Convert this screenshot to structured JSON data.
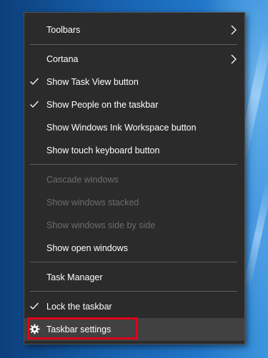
{
  "menu": {
    "items": [
      {
        "label": "Toolbars",
        "submenu": true,
        "checked": false,
        "enabled": true
      },
      {
        "label": "Cortana",
        "submenu": true,
        "checked": false,
        "enabled": true
      },
      {
        "label": "Show Task View button",
        "submenu": false,
        "checked": true,
        "enabled": true
      },
      {
        "label": "Show People on the taskbar",
        "submenu": false,
        "checked": true,
        "enabled": true
      },
      {
        "label": "Show Windows Ink Workspace button",
        "submenu": false,
        "checked": false,
        "enabled": true
      },
      {
        "label": "Show touch keyboard button",
        "submenu": false,
        "checked": false,
        "enabled": true
      },
      {
        "label": "Cascade windows",
        "submenu": false,
        "checked": false,
        "enabled": false
      },
      {
        "label": "Show windows stacked",
        "submenu": false,
        "checked": false,
        "enabled": false
      },
      {
        "label": "Show windows side by side",
        "submenu": false,
        "checked": false,
        "enabled": false
      },
      {
        "label": "Show open windows",
        "submenu": false,
        "checked": false,
        "enabled": true
      },
      {
        "label": "Task Manager",
        "submenu": false,
        "checked": false,
        "enabled": true
      },
      {
        "label": "Lock the taskbar",
        "submenu": false,
        "checked": true,
        "enabled": true
      },
      {
        "label": "Taskbar settings",
        "submenu": false,
        "checked": false,
        "enabled": true,
        "icon": "gear-icon",
        "hovered": true
      }
    ]
  },
  "colors": {
    "menu_background": "#2b2b2b",
    "menu_text": "#ffffff",
    "disabled_text": "#6d6d6d",
    "hover_background": "#414141",
    "highlight_border": "#e0001b"
  }
}
